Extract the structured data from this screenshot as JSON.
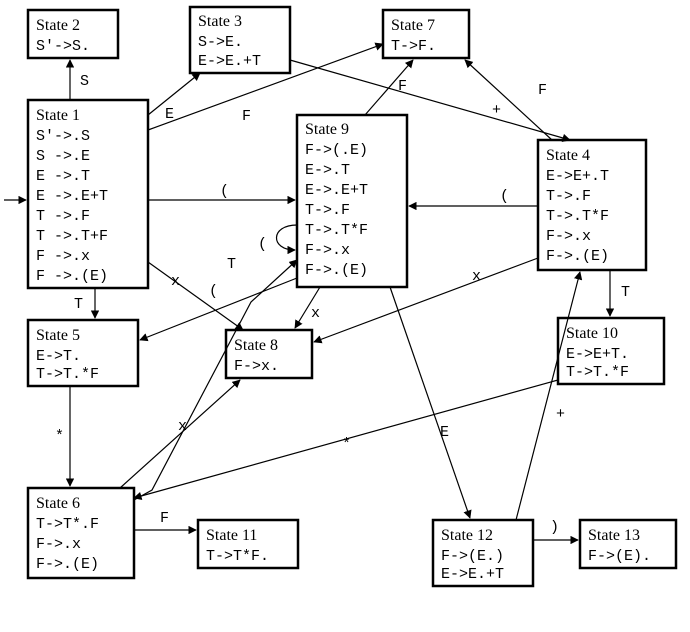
{
  "diagram": {
    "states": {
      "1": {
        "title": "State 1",
        "items": [
          "S'->.S",
          "S ->.E",
          "E ->.T",
          "E ->.E+T",
          "T ->.F",
          "T ->.T+F",
          "F ->.x",
          "F ->.(E)"
        ]
      },
      "2": {
        "title": "State 2",
        "items": [
          "S'->S."
        ]
      },
      "3": {
        "title": "State 3",
        "items": [
          "S->E.",
          "E->E.+T"
        ]
      },
      "4": {
        "title": "State 4",
        "items": [
          "E->E+.T",
          "T->.F",
          "T->.T*F",
          "F->.x",
          "F->.(E)"
        ]
      },
      "5": {
        "title": "State 5",
        "items": [
          "E->T.",
          "T->T.*F"
        ]
      },
      "6": {
        "title": "State 6",
        "items": [
          "T->T*.F",
          "F->.x",
          "F->.(E)"
        ]
      },
      "7": {
        "title": "State 7",
        "items": [
          "T->F."
        ]
      },
      "8": {
        "title": "State 8",
        "items": [
          "F->x."
        ]
      },
      "9": {
        "title": "State 9",
        "items": [
          "F->(.E)",
          "E->.T",
          "E->.E+T",
          "T->.F",
          "T->.T*F",
          "F->.x",
          "F->.(E)"
        ]
      },
      "10": {
        "title": "State 10",
        "items": [
          "E->E+T.",
          "T->T.*F"
        ]
      },
      "11": {
        "title": "State 11",
        "items": [
          "T->T*F."
        ]
      },
      "12": {
        "title": "State 12",
        "items": [
          "F->(E.)",
          "E->E.+T"
        ]
      },
      "13": {
        "title": "State 13",
        "items": [
          "F->(E)."
        ]
      }
    },
    "edges": [
      {
        "from": "start",
        "to": "1",
        "label": ""
      },
      {
        "from": "1",
        "to": "2",
        "label": "S"
      },
      {
        "from": "1",
        "to": "3",
        "label": "E"
      },
      {
        "from": "1",
        "to": "7",
        "label": "F"
      },
      {
        "from": "1",
        "to": "9",
        "label": "("
      },
      {
        "from": "1",
        "to": "5",
        "label": "T"
      },
      {
        "from": "1",
        "to": "8",
        "label": "x"
      },
      {
        "from": "3",
        "to": "4",
        "label": "+"
      },
      {
        "from": "4",
        "to": "7",
        "label": "F"
      },
      {
        "from": "4",
        "to": "9",
        "label": "("
      },
      {
        "from": "4",
        "to": "10",
        "label": "T"
      },
      {
        "from": "4",
        "to": "8",
        "label": "x"
      },
      {
        "from": "5",
        "to": "6",
        "label": "*"
      },
      {
        "from": "6",
        "to": "11",
        "label": "F"
      },
      {
        "from": "6",
        "to": "8",
        "label": "x"
      },
      {
        "from": "6",
        "to": "9",
        "label": "("
      },
      {
        "from": "9",
        "to": "9",
        "label": "("
      },
      {
        "from": "9",
        "to": "5",
        "label": "T"
      },
      {
        "from": "9",
        "to": "7",
        "label": "F"
      },
      {
        "from": "9",
        "to": "12",
        "label": "E"
      },
      {
        "from": "9",
        "to": "8",
        "label": "x"
      },
      {
        "from": "10",
        "to": "6",
        "label": "*"
      },
      {
        "from": "12",
        "to": "4",
        "label": "+"
      },
      {
        "from": "12",
        "to": "13",
        "label": ")"
      }
    ]
  }
}
